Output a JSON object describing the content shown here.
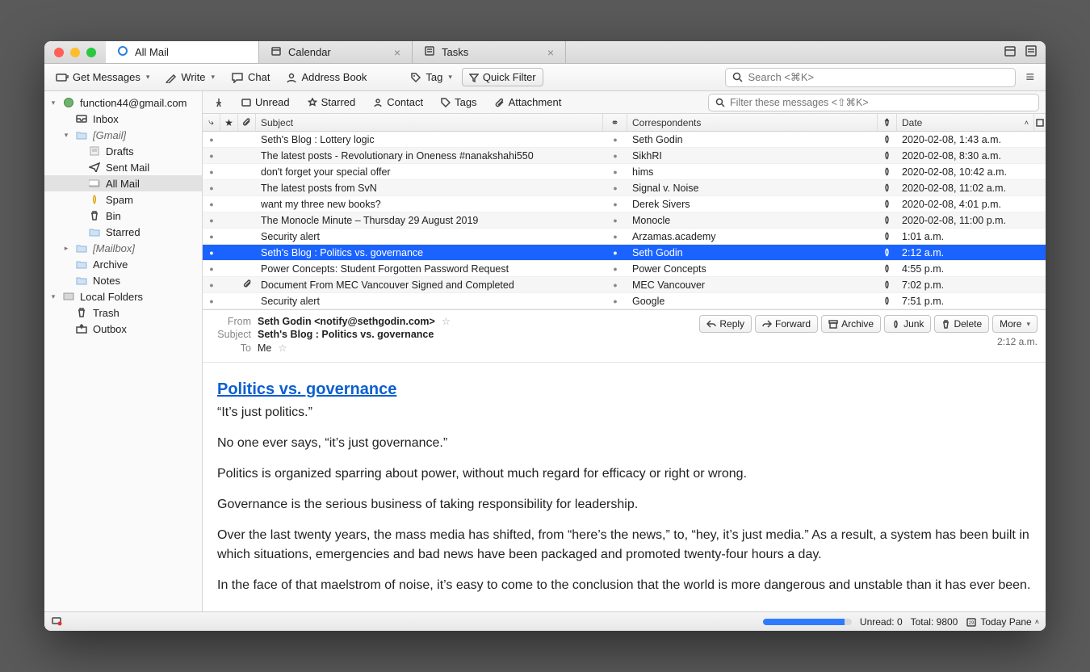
{
  "tabs": [
    {
      "label": "All Mail",
      "active": true,
      "closable": false,
      "icon": "mail"
    },
    {
      "label": "Calendar",
      "active": false,
      "closable": true,
      "icon": "calendar"
    },
    {
      "label": "Tasks",
      "active": false,
      "closable": true,
      "icon": "tasks"
    }
  ],
  "toolbar": {
    "get_messages": "Get Messages",
    "write": "Write",
    "chat": "Chat",
    "address_book": "Address Book",
    "tag": "Tag",
    "quick_filter": "Quick Filter",
    "search_placeholder": "Search <⌘K>"
  },
  "sidebar": [
    {
      "depth": 0,
      "twisty": "▾",
      "icon": "account",
      "label": "function44@gmail.com"
    },
    {
      "depth": 1,
      "twisty": "",
      "icon": "inbox",
      "label": "Inbox"
    },
    {
      "depth": 1,
      "twisty": "▾",
      "icon": "folder",
      "label": "[Gmail]",
      "italic": true
    },
    {
      "depth": 2,
      "twisty": "",
      "icon": "drafts",
      "label": "Drafts"
    },
    {
      "depth": 2,
      "twisty": "",
      "icon": "sent",
      "label": "Sent Mail"
    },
    {
      "depth": 2,
      "twisty": "",
      "icon": "allmail",
      "label": "All Mail",
      "selected": true
    },
    {
      "depth": 2,
      "twisty": "",
      "icon": "spam",
      "label": "Spam"
    },
    {
      "depth": 2,
      "twisty": "",
      "icon": "bin",
      "label": "Bin"
    },
    {
      "depth": 2,
      "twisty": "",
      "icon": "folder",
      "label": "Starred"
    },
    {
      "depth": 1,
      "twisty": "▸",
      "icon": "folder",
      "label": "[Mailbox]",
      "italic": true
    },
    {
      "depth": 1,
      "twisty": "",
      "icon": "folder",
      "label": "Archive"
    },
    {
      "depth": 1,
      "twisty": "",
      "icon": "folder",
      "label": "Notes"
    },
    {
      "depth": 0,
      "twisty": "▾",
      "icon": "local",
      "label": "Local Folders"
    },
    {
      "depth": 1,
      "twisty": "",
      "icon": "trash",
      "label": "Trash"
    },
    {
      "depth": 1,
      "twisty": "",
      "icon": "outbox",
      "label": "Outbox"
    }
  ],
  "filters": {
    "unread": "Unread",
    "starred": "Starred",
    "contact": "Contact",
    "tags": "Tags",
    "attachment": "Attachment",
    "filter_placeholder": "Filter these messages <⇧⌘K>"
  },
  "columns": {
    "subject": "Subject",
    "correspondents": "Correspondents",
    "date": "Date"
  },
  "messages": [
    {
      "subject": "Seth's Blog : Lottery logic",
      "from": "Seth Godin",
      "date": "2020-02-08, 1:43 a.m."
    },
    {
      "subject": "The latest posts - Revolutionary in Oneness #nanakshahi550",
      "from": "SikhRI",
      "date": "2020-02-08, 8:30 a.m."
    },
    {
      "subject": "don't forget your special offer",
      "from": "hims",
      "date": "2020-02-08, 10:42 a.m."
    },
    {
      "subject": "The latest posts from SvN",
      "from": "Signal v. Noise",
      "date": "2020-02-08, 11:02 a.m."
    },
    {
      "subject": "want my three new books?",
      "from": "Derek Sivers",
      "date": "2020-02-08, 4:01 p.m."
    },
    {
      "subject": "The Monocle Minute – Thursday 29 August 2019",
      "from": "Monocle",
      "date": "2020-02-08, 11:00 p.m."
    },
    {
      "subject": "Security alert",
      "from": "Arzamas.academy",
      "date": "1:01 a.m."
    },
    {
      "subject": "Seth's Blog : Politics vs. governance",
      "from": "Seth Godin",
      "date": "2:12 a.m.",
      "selected": true
    },
    {
      "subject": "Power Concepts: Student Forgotten Password Request",
      "from": "Power Concepts",
      "date": "4:55 p.m."
    },
    {
      "subject": "Document From MEC Vancouver Signed and Completed",
      "from": "MEC Vancouver",
      "date": "7:02 p.m.",
      "attach": true
    },
    {
      "subject": "Security alert",
      "from": "Google",
      "date": "7:51 p.m."
    }
  ],
  "preview": {
    "from_label": "From",
    "from_value": "Seth Godin <notify@sethgodin.com>",
    "subject_label": "Subject",
    "subject_value": "Seth's Blog : Politics vs. governance",
    "to_label": "To",
    "to_value": "Me",
    "time": "2:12 a.m.",
    "actions": {
      "reply": "Reply",
      "forward": "Forward",
      "archive": "Archive",
      "junk": "Junk",
      "delete": "Delete",
      "more": "More"
    },
    "title": "Politics vs. governance",
    "paras": [
      "“It’s just politics.”",
      "No one ever says, “it’s just governance.”",
      "Politics is organized sparring about power, without much regard for efficacy or right or wrong.",
      "Governance is the serious business of taking responsibility for leadership.",
      "Over the last twenty years, the mass media has shifted, from “here’s the news,” to, “hey, it’s just media.” As a result, a system has been built in which situations, emergencies and bad news have been packaged and promoted twenty-four hours a day.",
      "In the face of that maelstrom of noise, it’s easy to come to the conclusion that the world is more dangerous and unstable than it has ever been."
    ]
  },
  "status": {
    "unread": "Unread: 0",
    "total": "Total: 9800",
    "today_pane": "Today Pane"
  }
}
